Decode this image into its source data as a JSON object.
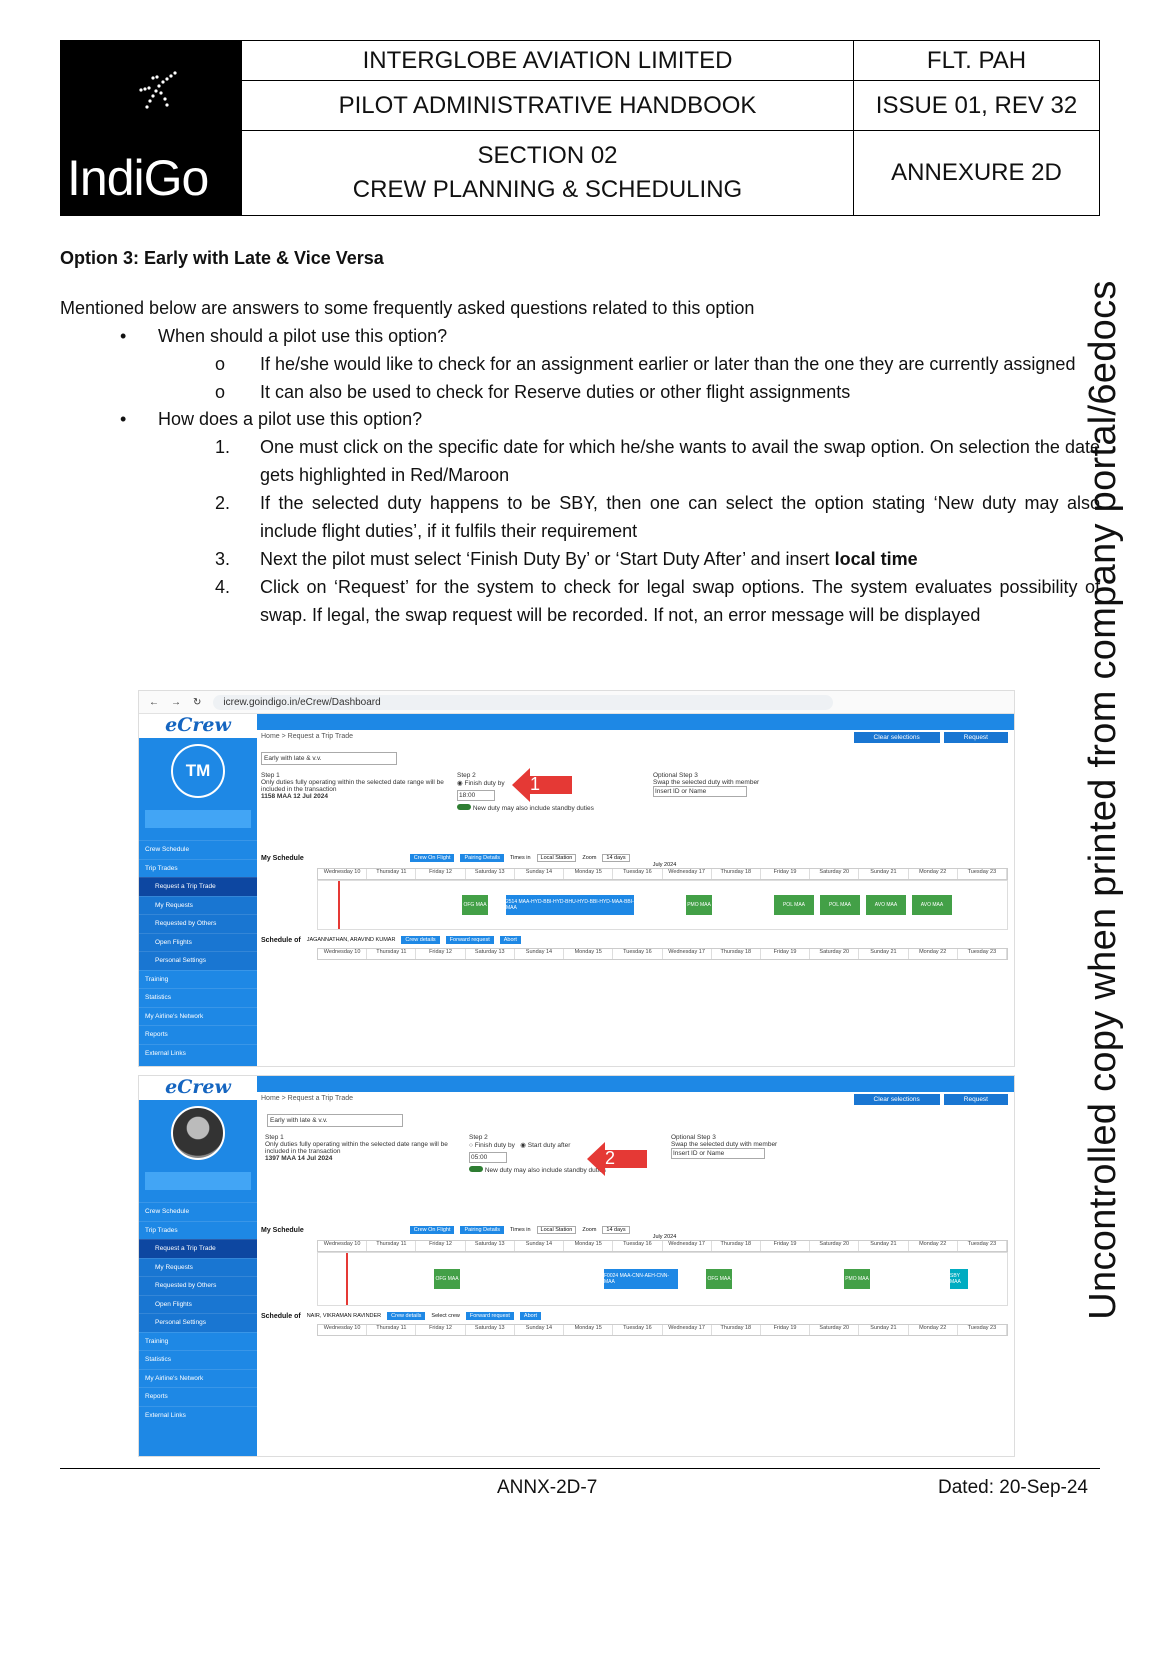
{
  "header": {
    "logo_text": "IndiGo",
    "company": "INTERGLOBE AVIATION LIMITED",
    "doc_code": "FLT. PAH",
    "handbook": "PILOT ADMINISTRATIVE HANDBOOK",
    "issue": "ISSUE 01, REV 32",
    "section_line1": "SECTION 02",
    "section_line2": "CREW PLANNING & SCHEDULING",
    "annexure": "ANNEXURE 2D"
  },
  "watermark": "Uncontrolled copy when printed from company portal/6edocs",
  "content": {
    "heading": "Option 3: Early with Late & Vice Versa",
    "intro": "Mentioned below are answers to some frequently asked questions related to this option",
    "q1": "When should a pilot use this option?",
    "q1_items": [
      "If he/she would like to check for an assignment earlier or later than the one they are currently assigned",
      "It can also be used to check for Reserve duties or other flight assignments"
    ],
    "q2": "How does a pilot use this option?",
    "q2_items": [
      "One must click on the specific date for which he/she wants to avail the swap option. On selection the date gets highlighted in Red/Maroon",
      "If the selected duty happens to be SBY, then one can select the option stating ‘New duty may also include flight duties’, if it fulfils their requirement",
      "Next the pilot must select ‘Finish Duty By’ or ‘Start Duty After’ and insert",
      "Click on ‘Request’ for the system to check for legal swap options. The system evaluates possibility of swap. If legal, the swap request will be recorded. If not, an error message will be displayed"
    ],
    "q2_item3_bold": "local time",
    "markers": [
      "1.",
      "2.",
      "3.",
      "4."
    ],
    "sub_marker": "o",
    "bullet": "•"
  },
  "screenshots": {
    "url": "icrew.goindigo.in/eCrew/Dashboard",
    "brand": "eCrew",
    "initials1": "TM",
    "breadcrumb": "Home  >  Request a Trip Trade",
    "clear_btn": "Clear selections",
    "request_btn": "Request",
    "dropdown": "Early with late & v.v.",
    "step1": "Step 1",
    "step1_text": "Only duties fully operating within the selected date range will be included in the transaction",
    "step1_duty_a": "1158 MAA 12 Jul 2024",
    "step1_duty_b": "1397 MAA 14 Jul 2024",
    "step2": "Step 2",
    "finish_duty": "Finish duty by",
    "start_duty": "Start duty after",
    "time_a": "18:00",
    "time_b": "05:00",
    "standby_toggle": "New duty may also include standby duties",
    "opt_step3": "Optional Step 3",
    "opt_step3_text": "Swap the selected duty with member",
    "insert_id": "Insert ID or Name",
    "my_schedule": "My Schedule",
    "crew_on_flight": "Crew On Flight",
    "pairing_details": "Pairing Details",
    "times_in": "Times in",
    "local_station": "Local Station",
    "zoom": "Zoom",
    "zoom_val": "14 days",
    "month": "July 2024",
    "schedule_of_a": "JAGANNATHAN, ARAVIND KUMAR",
    "schedule_of_b": "NAIR, VIKRAMAN RAVINDER",
    "schedule_of": "Schedule of",
    "crew_details": "Crew details",
    "select_crew": "Select crew",
    "forward_request": "Forward request",
    "abort": "Abort",
    "days": [
      "Wednesday",
      "Thursday",
      "Friday",
      "Saturday",
      "Sunday",
      "Monday",
      "Tuesday",
      "Wednesday",
      "Thursday",
      "Friday",
      "Saturday",
      "Sunday",
      "Monday",
      "Tuesday"
    ],
    "dates": [
      "10",
      "11",
      "12",
      "13",
      "14",
      "15",
      "16",
      "17",
      "18",
      "19",
      "20",
      "21",
      "22",
      "23"
    ],
    "nav": [
      "Crew Schedule",
      "Trip Trades",
      "Request a Trip Trade",
      "My Requests",
      "Requested by Others",
      "Open Flights",
      "Personal Settings",
      "Training",
      "Statistics",
      "My Airline's Network",
      "Reports",
      "External Links"
    ],
    "arrow1": "1",
    "arrow2": "2",
    "blocks_a": [
      "OFG MAA",
      "2514 MAA-HYD-BBI-HYD-BHU-HYD-BBI-HYD-MAA-BBI-MAA",
      "PMO MAA",
      "POL MAA",
      "POL MAA",
      "AVO MAA",
      "AVO MAA"
    ],
    "blocks_b": [
      "OFG MAA",
      "F0024 MAA-CNN-AEH-CNN-MAA",
      "OFG MAA",
      "PMO MAA",
      "SBY MAA"
    ]
  },
  "footer": {
    "page": "ANNX-2D-7",
    "date": "Dated: 20-Sep-24"
  }
}
